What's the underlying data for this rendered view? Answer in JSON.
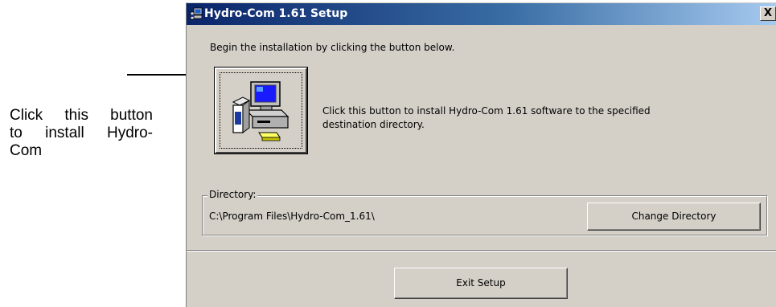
{
  "annotation": {
    "lines": [
      "Click this button",
      "to install Hydro-",
      "Com"
    ]
  },
  "window": {
    "title": "Hydro-Com 1.61 Setup",
    "close_label": "X"
  },
  "intro_text": "Begin the installation by clicking the button below.",
  "install_button": {
    "icon": "computer-setup-icon",
    "desc_line1": "Click this button to install Hydro-Com 1.61 software to the specified",
    "desc_line2": "destination directory."
  },
  "directory": {
    "label": "Directory:",
    "path": "C:\\Program Files\\Hydro-Com_1.61\\",
    "change_button_label": "Change Directory"
  },
  "exit_button_label": "Exit Setup",
  "colors": {
    "window_bg": "#d4d0c8",
    "title_start": "#0a246a",
    "title_end": "#a6caf0"
  }
}
